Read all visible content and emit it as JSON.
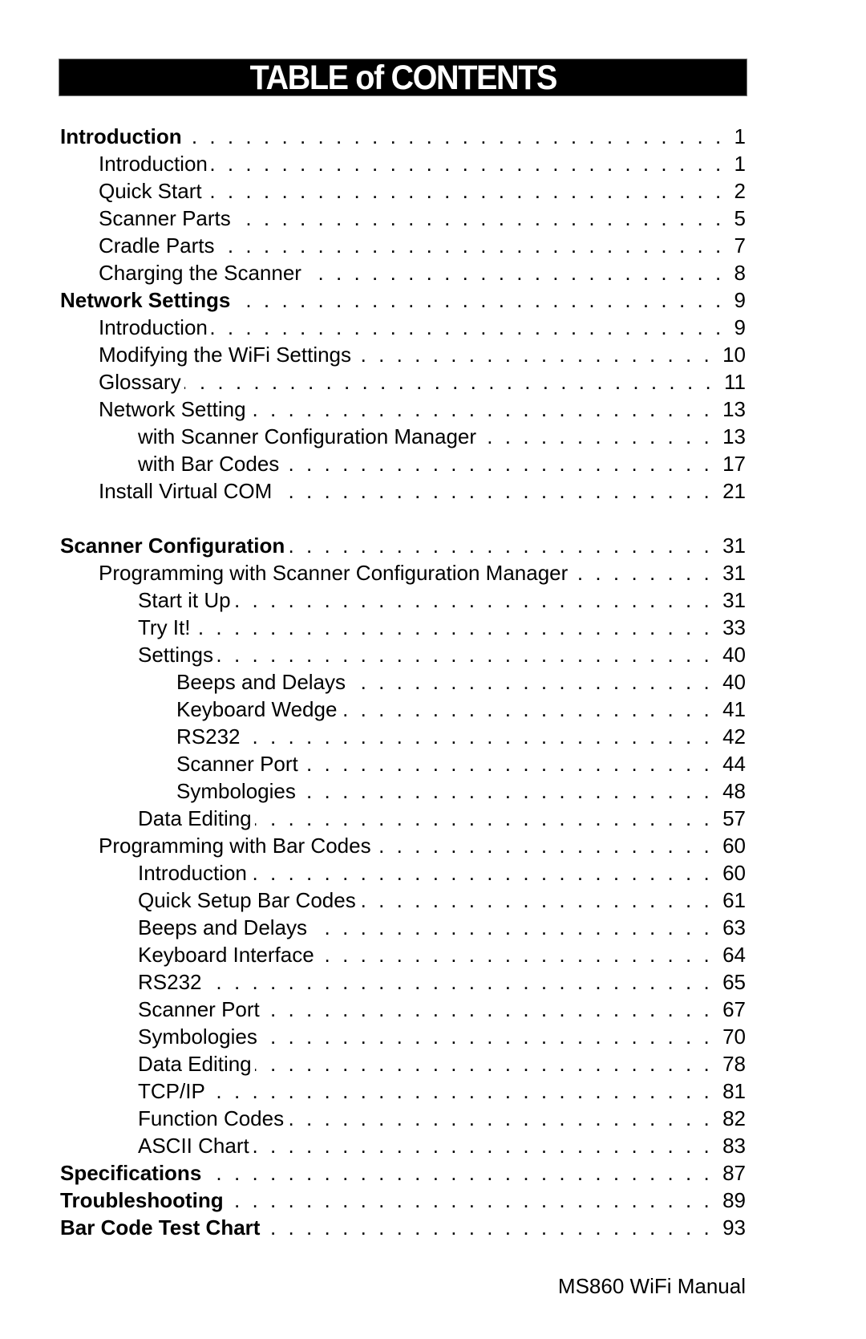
{
  "title": "TABLE of CONTENTS",
  "entries": [
    {
      "label": "Introduction",
      "page": "1",
      "level": 0
    },
    {
      "label": "Introduction",
      "page": "1",
      "level": 1
    },
    {
      "label": "Quick Start",
      "page": "2",
      "level": 1
    },
    {
      "label": "Scanner Parts",
      "page": "5",
      "level": 1
    },
    {
      "label": "Cradle Parts",
      "page": "7",
      "level": 1
    },
    {
      "label": "Charging the Scanner",
      "page": "8",
      "level": 1
    },
    {
      "label": "Network Settings",
      "page": "9",
      "level": 0
    },
    {
      "label": "Introduction",
      "page": "9",
      "level": 1
    },
    {
      "label": "Modifying the WiFi Settings",
      "page": "10",
      "level": 1
    },
    {
      "label": "Glossary",
      "page": "11",
      "level": 1
    },
    {
      "label": "Network Setting",
      "page": "13",
      "level": 1
    },
    {
      "label": "with Scanner Configuration Manager",
      "page": "13",
      "level": 2
    },
    {
      "label": "with Bar Codes",
      "page": "17",
      "level": 2
    },
    {
      "label": "Install Virtual COM",
      "page": "21",
      "level": 1
    },
    {
      "label": "Scanner Configuration",
      "page": "31",
      "level": 0,
      "gap_before": true
    },
    {
      "label": "Programming with Scanner Configuration Manager",
      "page": "31",
      "level": 1
    },
    {
      "label": "Start it Up",
      "page": "31",
      "level": 2
    },
    {
      "label": "Try It!",
      "page": "33",
      "level": 2
    },
    {
      "label": "Settings",
      "page": "40",
      "level": 2
    },
    {
      "label": "Beeps and Delays",
      "page": "40",
      "level": 3
    },
    {
      "label": "Keyboard Wedge",
      "page": "41",
      "level": 3
    },
    {
      "label": "RS232",
      "page": "42",
      "level": 3
    },
    {
      "label": "Scanner Port",
      "page": "44",
      "level": 3
    },
    {
      "label": "Symbologies",
      "page": "48",
      "level": 3
    },
    {
      "label": "Data Editing",
      "page": "57",
      "level": 2
    },
    {
      "label": "Programming with Bar Codes",
      "page": "60",
      "level": 1
    },
    {
      "label": "Introduction",
      "page": "60",
      "level": 2
    },
    {
      "label": "Quick Setup Bar Codes",
      "page": "61",
      "level": 2
    },
    {
      "label": "Beeps and Delays",
      "page": "63",
      "level": 2
    },
    {
      "label": "Keyboard Interface",
      "page": "64",
      "level": 2
    },
    {
      "label": "RS232",
      "page": "65",
      "level": 2
    },
    {
      "label": "Scanner Port",
      "page": "67",
      "level": 2
    },
    {
      "label": "Symbologies",
      "page": "70",
      "level": 2
    },
    {
      "label": "Data Editing",
      "page": "78",
      "level": 2
    },
    {
      "label": "TCP/IP",
      "page": "81",
      "level": 2
    },
    {
      "label": "Function Codes",
      "page": "82",
      "level": 2
    },
    {
      "label": "ASCII Chart",
      "page": "83",
      "level": 2
    },
    {
      "label": "Specifications",
      "page": "87",
      "level": 0
    },
    {
      "label": "Troubleshooting",
      "page": "89",
      "level": 0
    },
    {
      "label": "Bar Code Test Chart",
      "page": "93",
      "level": 0
    }
  ],
  "footer": "MS860 WiFi Manual"
}
